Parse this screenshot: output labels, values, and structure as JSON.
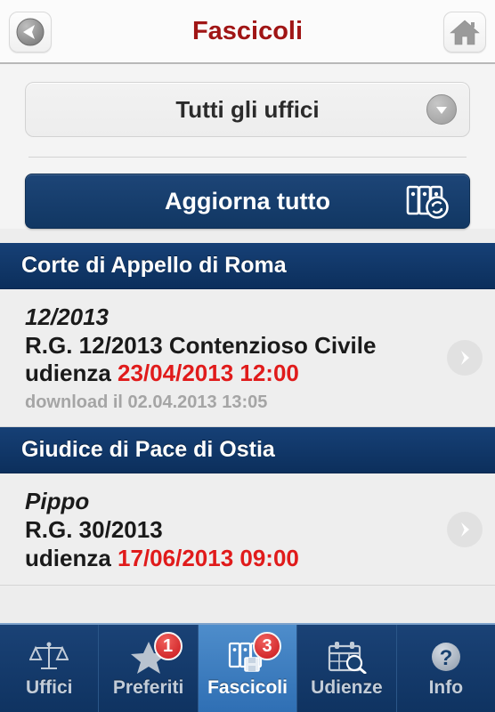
{
  "header": {
    "title": "Fascicoli",
    "title_color": "#A01515",
    "back_icon": "back-arrow-icon",
    "home_icon": "home-icon"
  },
  "toolbar": {
    "office_filter_value": "Tutti gli uffici",
    "office_filter_caret_icon": "chevron-down-icon",
    "update_all_label": "Aggiorna tutto",
    "update_all_icon": "folders-refresh-icon",
    "update_all_bg": "#123B68"
  },
  "sections": [
    {
      "title": "Corte di Appello di Roma",
      "rows": [
        {
          "code": "12/2013",
          "main_prefix": "R.G. 12/2013 Contenzioso Civile",
          "hearing_label": "udienza",
          "hearing_value": "23/04/2013 12:00",
          "hearing_color": "#E01B1B",
          "sub": "download il 02.04.2013 13:05",
          "disclosure_icon": "chevron-right-icon"
        }
      ]
    },
    {
      "title": "Giudice di Pace di Ostia",
      "rows": [
        {
          "code": "Pippo",
          "main_prefix": "R.G. 30/2013",
          "hearing_label": "udienza",
          "hearing_value": "17/06/2013 09:00",
          "hearing_color": "#E01B1B",
          "sub": "",
          "disclosure_icon": "chevron-right-icon"
        }
      ]
    }
  ],
  "tabbar": {
    "tabs": [
      {
        "label": "Uffici",
        "icon": "scales-of-justice-icon",
        "badge": "",
        "active": false
      },
      {
        "label": "Preferiti",
        "icon": "star-icon",
        "badge": "1",
        "active": false
      },
      {
        "label": "Fascicoli",
        "icon": "folders-icon",
        "badge": "3",
        "active": true
      },
      {
        "label": "Udienze",
        "icon": "calendar-search-icon",
        "badge": "",
        "active": false
      },
      {
        "label": "Info",
        "icon": "question-mark-icon",
        "badge": "",
        "active": false
      }
    ],
    "badge_color": "#C8161B",
    "active_bg": "#3A7BC0"
  }
}
